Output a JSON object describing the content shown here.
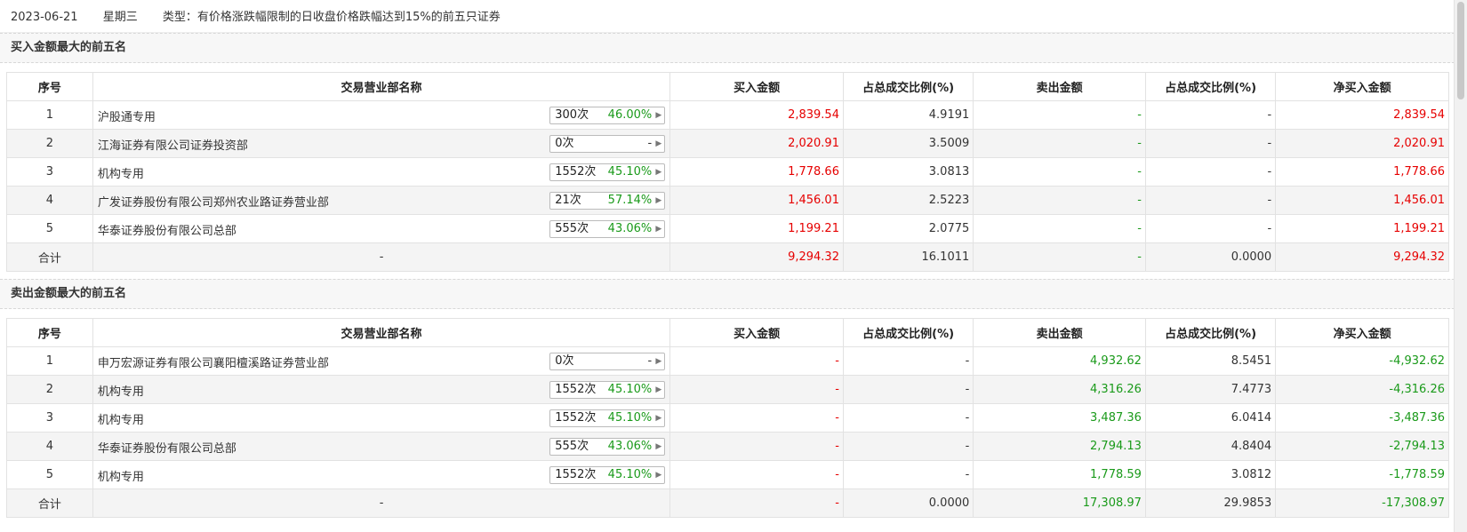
{
  "header": {
    "date": "2023-06-21",
    "weekday": "星期三",
    "type_label": "类型：",
    "type_value": "有价格涨跌幅限制的日收盘价格跌幅达到15%的前五只证券"
  },
  "columns": [
    "序号",
    "交易营业部名称",
    "买入金额",
    "占总成交比例(%)",
    "卖出金额",
    "占总成交比例(%)",
    "净买入金额"
  ],
  "buy_section": {
    "title": "买入金额最大的前五名",
    "rows": [
      {
        "no": "1",
        "name": "沪股通专用",
        "count": "300次",
        "rate": "46.00%",
        "buy": "2,839.54",
        "buy_pct": "4.9191",
        "sell": "-",
        "sell_pct": "-",
        "net": "2,839.54"
      },
      {
        "no": "2",
        "name": "江海证券有限公司证券投资部",
        "count": "0次",
        "rate": "-",
        "buy": "2,020.91",
        "buy_pct": "3.5009",
        "sell": "-",
        "sell_pct": "-",
        "net": "2,020.91"
      },
      {
        "no": "3",
        "name": "机构专用",
        "count": "1552次",
        "rate": "45.10%",
        "buy": "1,778.66",
        "buy_pct": "3.0813",
        "sell": "-",
        "sell_pct": "-",
        "net": "1,778.66"
      },
      {
        "no": "4",
        "name": "广发证券股份有限公司郑州农业路证券营业部",
        "count": "21次",
        "rate": "57.14%",
        "buy": "1,456.01",
        "buy_pct": "2.5223",
        "sell": "-",
        "sell_pct": "-",
        "net": "1,456.01"
      },
      {
        "no": "5",
        "name": "华泰证券股份有限公司总部",
        "count": "555次",
        "rate": "43.06%",
        "buy": "1,199.21",
        "buy_pct": "2.0775",
        "sell": "-",
        "sell_pct": "-",
        "net": "1,199.21"
      }
    ],
    "total": {
      "label": "合计",
      "name": "-",
      "buy": "9,294.32",
      "buy_pct": "16.1011",
      "sell": "-",
      "sell_pct": "0.0000",
      "net": "9,294.32"
    }
  },
  "sell_section": {
    "title": "卖出金额最大的前五名",
    "rows": [
      {
        "no": "1",
        "name": "申万宏源证券有限公司襄阳檀溪路证券营业部",
        "count": "0次",
        "rate": "-",
        "buy": "-",
        "buy_pct": "-",
        "sell": "4,932.62",
        "sell_pct": "8.5451",
        "net": "-4,932.62"
      },
      {
        "no": "2",
        "name": "机构专用",
        "count": "1552次",
        "rate": "45.10%",
        "buy": "-",
        "buy_pct": "-",
        "sell": "4,316.26",
        "sell_pct": "7.4773",
        "net": "-4,316.26"
      },
      {
        "no": "3",
        "name": "机构专用",
        "count": "1552次",
        "rate": "45.10%",
        "buy": "-",
        "buy_pct": "-",
        "sell": "3,487.36",
        "sell_pct": "6.0414",
        "net": "-3,487.36"
      },
      {
        "no": "4",
        "name": "华泰证券股份有限公司总部",
        "count": "555次",
        "rate": "43.06%",
        "buy": "-",
        "buy_pct": "-",
        "sell": "2,794.13",
        "sell_pct": "4.8404",
        "net": "-2,794.13"
      },
      {
        "no": "5",
        "name": "机构专用",
        "count": "1552次",
        "rate": "45.10%",
        "buy": "-",
        "buy_pct": "-",
        "sell": "1,778.59",
        "sell_pct": "3.0812",
        "net": "-1,778.59"
      }
    ],
    "total": {
      "label": "合计",
      "name": "-",
      "buy": "-",
      "buy_pct": "0.0000",
      "sell": "17,308.97",
      "sell_pct": "29.9853",
      "net": "-17,308.97"
    }
  },
  "colors": {
    "up": "#e60000",
    "down": "#1a9a1a",
    "alt_row": "#f4f4f4",
    "section_bg": "#f7f7f7"
  },
  "icons": {
    "badge_arrow": "triangle-right-icon"
  }
}
